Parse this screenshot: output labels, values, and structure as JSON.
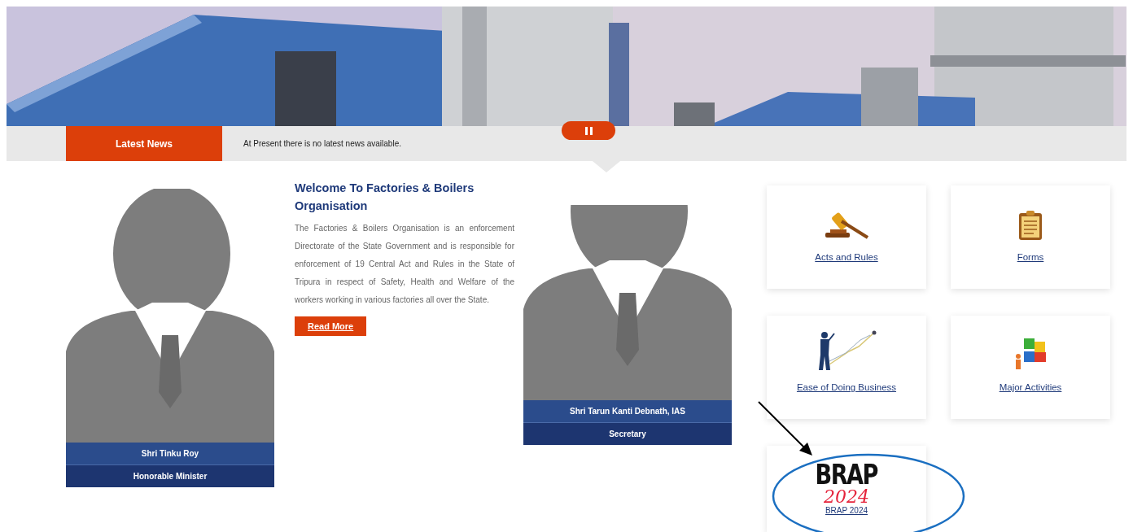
{
  "news": {
    "label": "Latest News",
    "message": "At Present there is no latest news available."
  },
  "people": [
    {
      "name": "Shri Tinku Roy",
      "role": "Honorable Minister"
    },
    {
      "name": "Shri Tarun Kanti Debnath, IAS",
      "role": "Secretary"
    }
  ],
  "welcome": {
    "title": "Welcome To Factories & Boilers Organisation",
    "body": "The Factories & Boilers Organisation is an enforcement Directorate of the State Government and is responsible for enforcement of 19 Central Act and Rules in the State of Tripura in respect of Safety, Health and Welfare of the workers working in various factories all over the State.",
    "button": "Read More"
  },
  "tiles": [
    {
      "kind": "gavel",
      "label": "Acts and Rules"
    },
    {
      "kind": "clipboard",
      "label": "Forms"
    },
    {
      "kind": "presenter",
      "label": "Ease of Doing Business"
    },
    {
      "kind": "puzzle",
      "label": "Major Activities"
    },
    {
      "kind": "logo",
      "logo_title": "BRAP",
      "logo_year": "2024",
      "label": "BRAP 2024"
    }
  ]
}
